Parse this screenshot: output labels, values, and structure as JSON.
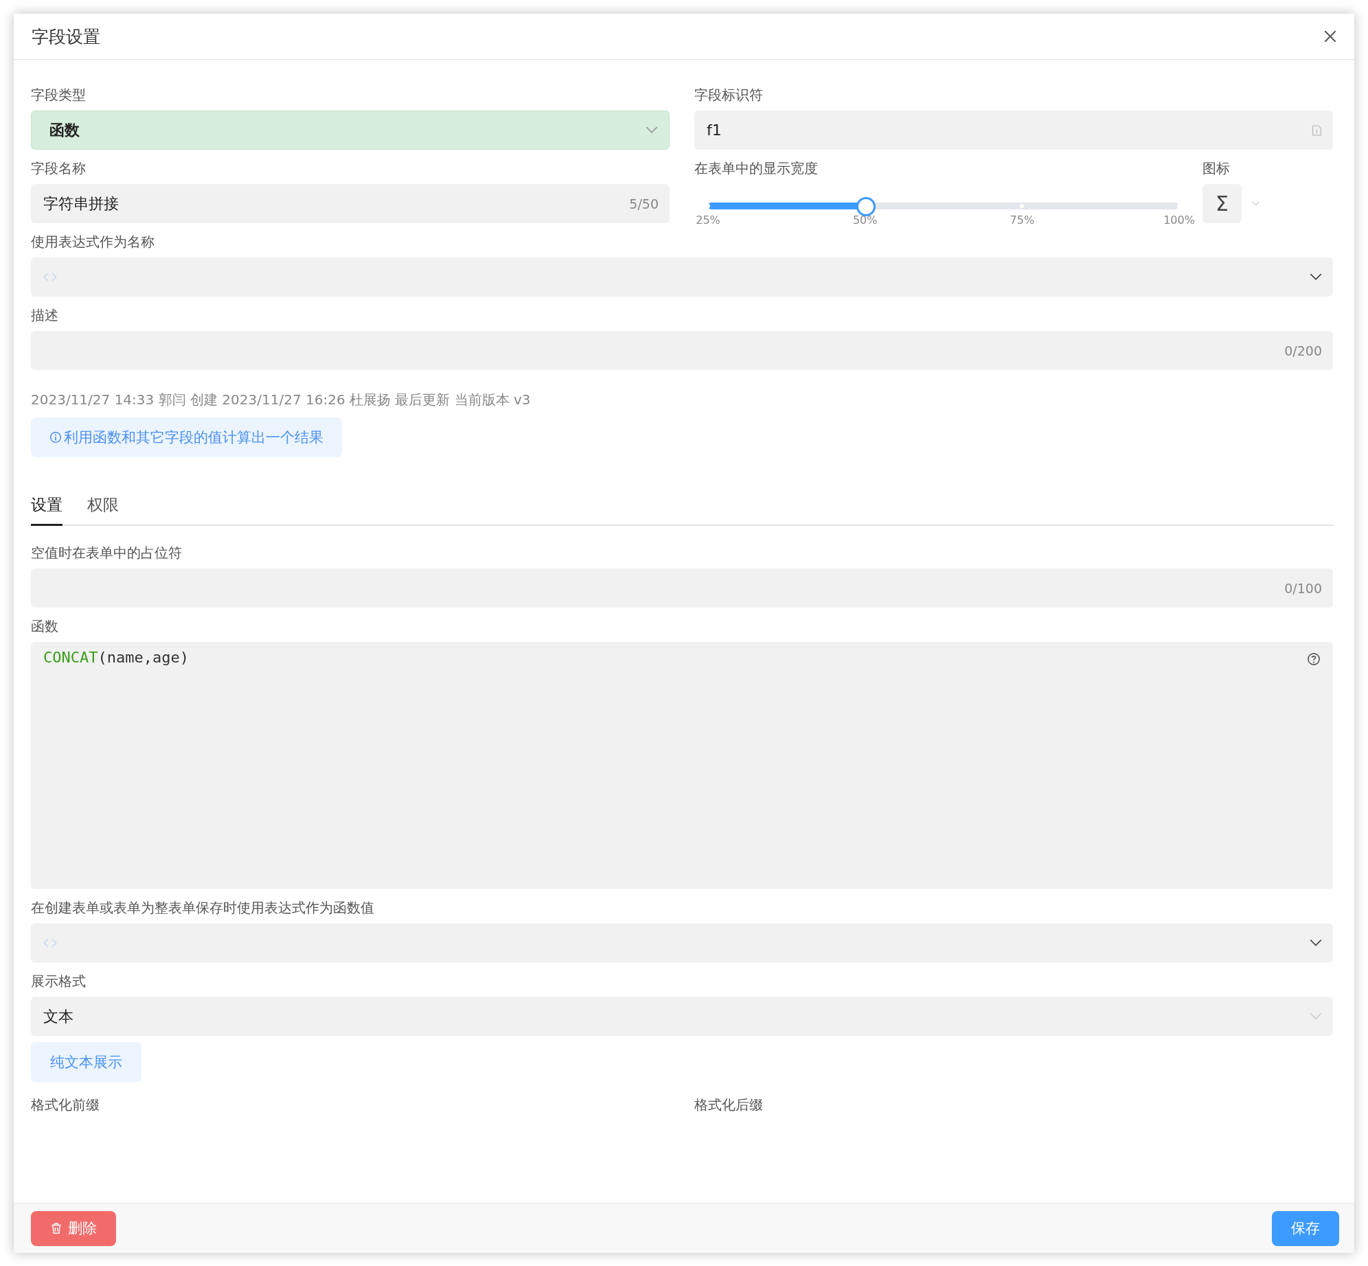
{
  "dialog": {
    "title": "字段设置"
  },
  "field_type": {
    "label": "字段类型",
    "value": "函数"
  },
  "identifier": {
    "label": "字段标识符",
    "value": "f1"
  },
  "field_name": {
    "label": "字段名称",
    "value": "字符串拼接",
    "counter": "5/50"
  },
  "display_width": {
    "label": "在表单中的显示宽度",
    "level": 0.3333,
    "marks": [
      "25%",
      "50%",
      "75%",
      "100%"
    ]
  },
  "icon_picker": {
    "label": "图标",
    "symbol": "Σ"
  },
  "name_expression": {
    "label": "使用表达式作为名称"
  },
  "description": {
    "label": "描述",
    "counter": "0/200"
  },
  "meta": "2023/11/27 14:33 郭闫 创建 2023/11/27 16:26 杜展扬 最后更新 当前版本 v3",
  "info_tip": "利用函数和其它字段的值计算出一个结果",
  "tabs": [
    {
      "label": "设置",
      "selected": true
    },
    {
      "label": "权限",
      "selected": false
    }
  ],
  "placeholder_field": {
    "label": "空值时在表单中的占位符",
    "counter": "0/100"
  },
  "function": {
    "label": "函数",
    "name": "CONCAT",
    "args": "(name,age)"
  },
  "save_expression": {
    "label": "在创建表单或表单为整表单保存时使用表达式作为函数值"
  },
  "display_format": {
    "label": "展示格式",
    "value": "文本",
    "hint": "纯文本展示"
  },
  "format_labels": [
    "格式化前缀",
    "格式化后缀"
  ],
  "footer": {
    "delete": "删除",
    "save": "保存"
  }
}
